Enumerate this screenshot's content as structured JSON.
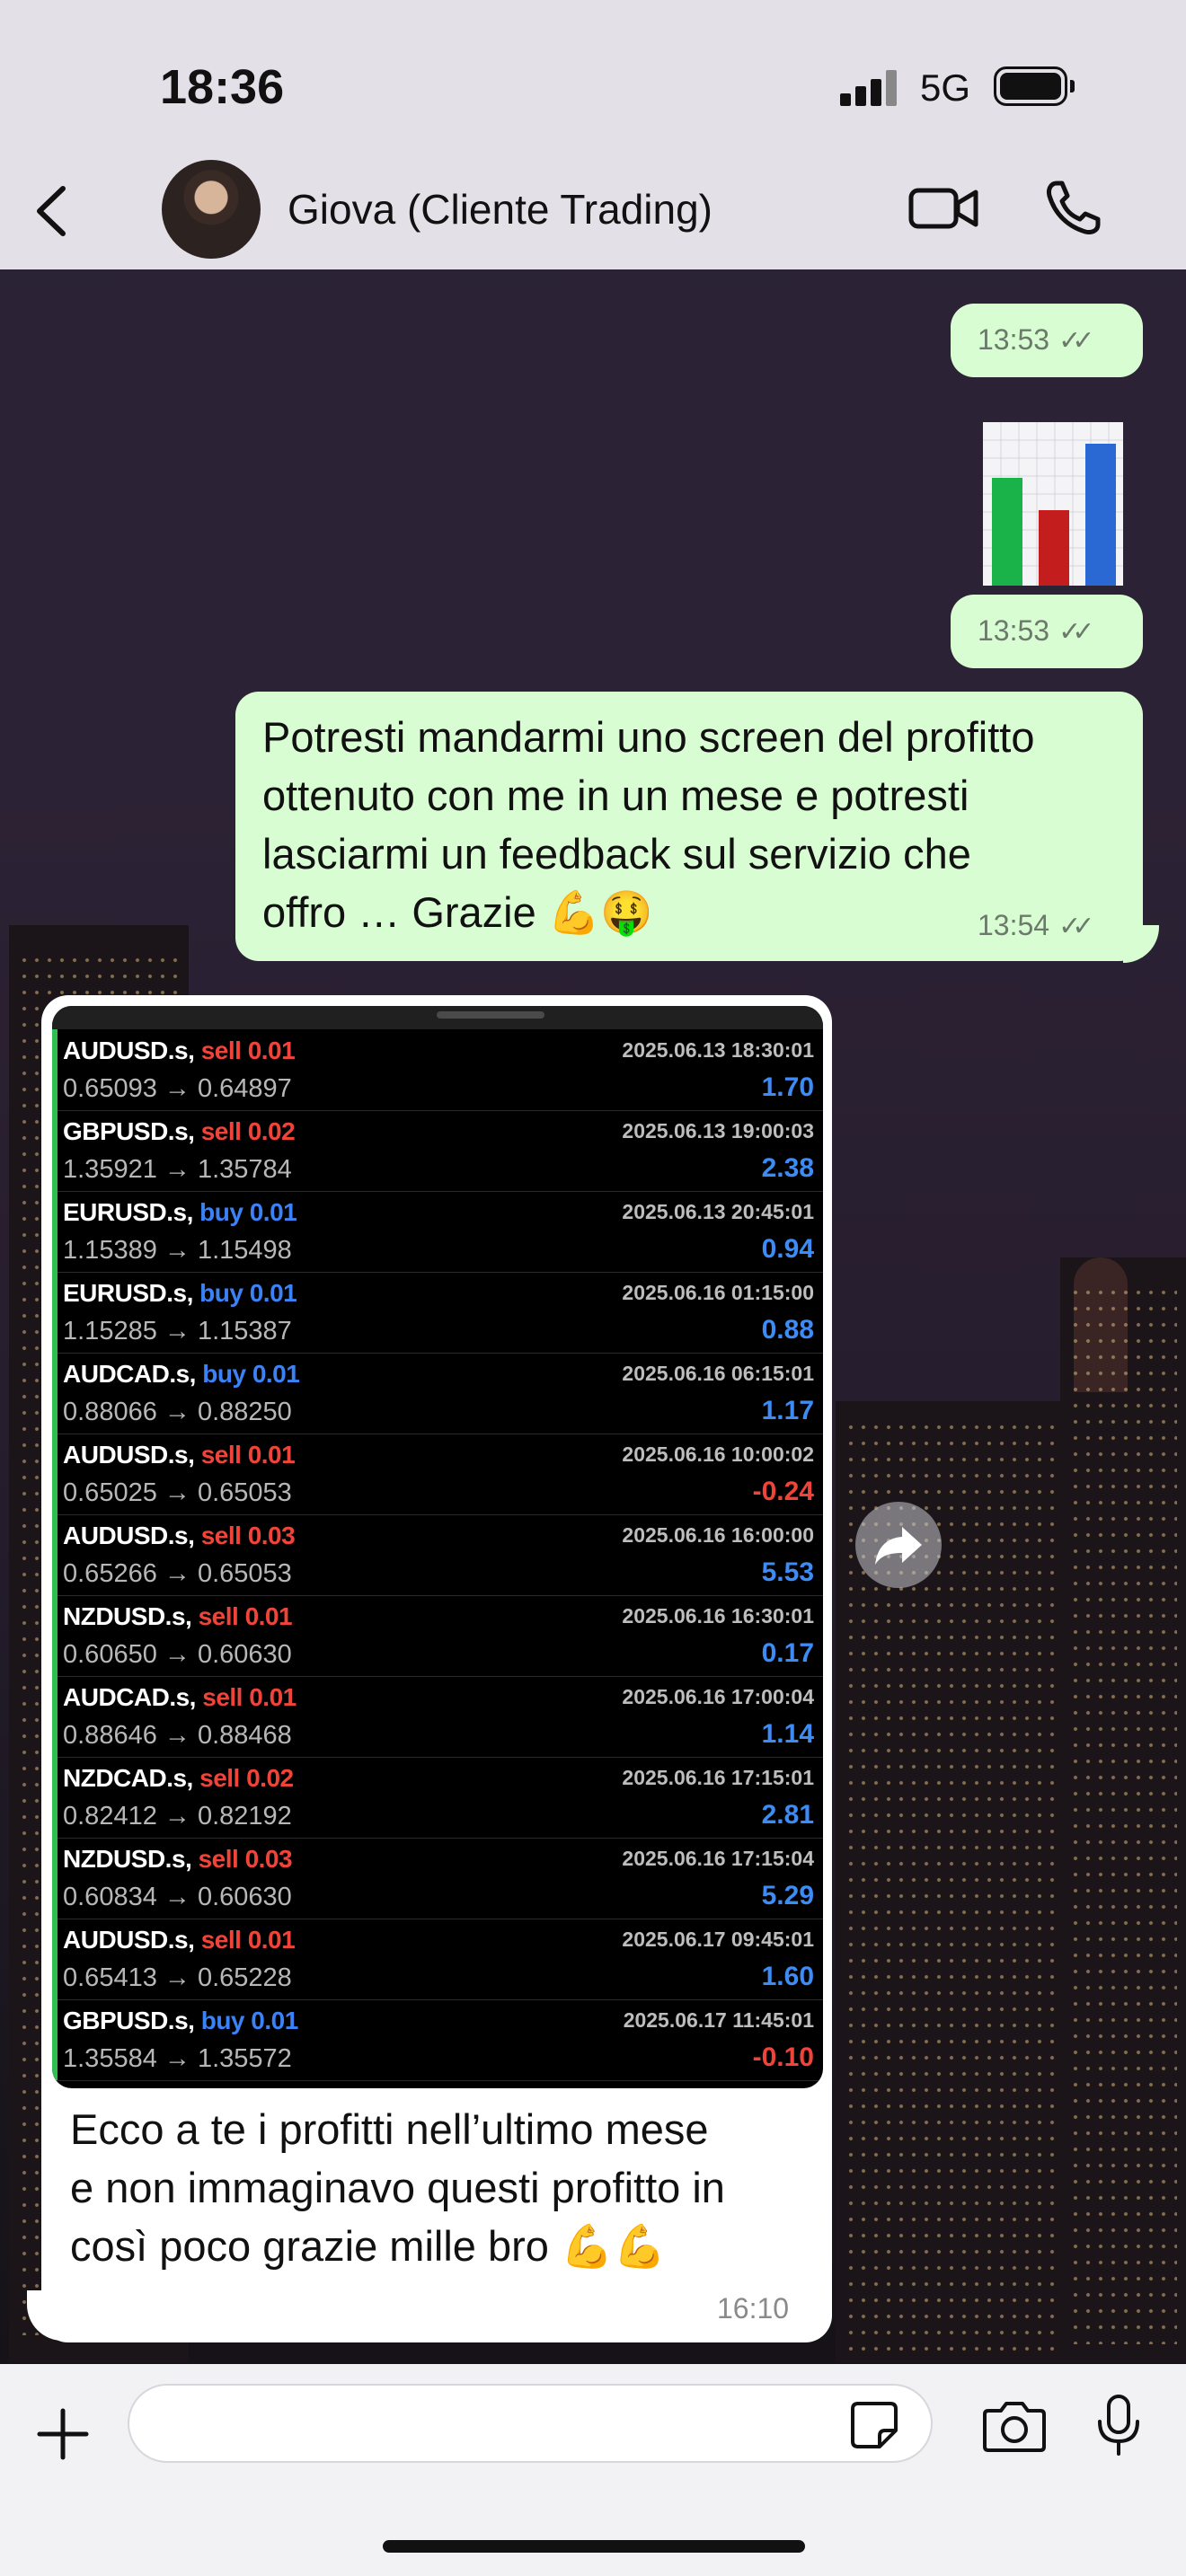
{
  "status": {
    "time": "18:36",
    "network": "5G"
  },
  "header": {
    "contact_name": "Giova (Cliente Trading)"
  },
  "messages": {
    "m1": {
      "time": "13:53"
    },
    "m2": {
      "time": "13:53",
      "emoji": "📊"
    },
    "m3": {
      "lines": [
        "Potresti mandarmi uno screen del profitto",
        "ottenuto con me in un mese e potresti",
        "lasciarmi un feedback sul servizio che",
        "offro … Grazie 💪🤑"
      ],
      "time": "13:54"
    },
    "m4": {
      "lines": [
        "Ecco a te i profitti nell’ultimo mese",
        "e non immaginavo questi profitto in",
        "così poco grazie mille bro 💪💪"
      ],
      "time": "16:10",
      "trades": [
        {
          "symbol": "AUDUSD.s,",
          "side": "sell",
          "lots": "0.01",
          "datetime": "2025.06.13 18:30:01",
          "open": "0.65093",
          "close": "0.64897",
          "profit": "1.70"
        },
        {
          "symbol": "GBPUSD.s,",
          "side": "sell",
          "lots": "0.02",
          "datetime": "2025.06.13 19:00:03",
          "open": "1.35921",
          "close": "1.35784",
          "profit": "2.38"
        },
        {
          "symbol": "EURUSD.s,",
          "side": "buy",
          "lots": "0.01",
          "datetime": "2025.06.13 20:45:01",
          "open": "1.15389",
          "close": "1.15498",
          "profit": "0.94"
        },
        {
          "symbol": "EURUSD.s,",
          "side": "buy",
          "lots": "0.01",
          "datetime": "2025.06.16 01:15:00",
          "open": "1.15285",
          "close": "1.15387",
          "profit": "0.88"
        },
        {
          "symbol": "AUDCAD.s,",
          "side": "buy",
          "lots": "0.01",
          "datetime": "2025.06.16 06:15:01",
          "open": "0.88066",
          "close": "0.88250",
          "profit": "1.17"
        },
        {
          "symbol": "AUDUSD.s,",
          "side": "sell",
          "lots": "0.01",
          "datetime": "2025.06.16 10:00:02",
          "open": "0.65025",
          "close": "0.65053",
          "profit": "-0.24"
        },
        {
          "symbol": "AUDUSD.s,",
          "side": "sell",
          "lots": "0.03",
          "datetime": "2025.06.16 16:00:00",
          "open": "0.65266",
          "close": "0.65053",
          "profit": "5.53"
        },
        {
          "symbol": "NZDUSD.s,",
          "side": "sell",
          "lots": "0.01",
          "datetime": "2025.06.16 16:30:01",
          "open": "0.60650",
          "close": "0.60630",
          "profit": "0.17"
        },
        {
          "symbol": "AUDCAD.s,",
          "side": "sell",
          "lots": "0.01",
          "datetime": "2025.06.16 17:00:04",
          "open": "0.88646",
          "close": "0.88468",
          "profit": "1.14"
        },
        {
          "symbol": "NZDCAD.s,",
          "side": "sell",
          "lots": "0.02",
          "datetime": "2025.06.16 17:15:01",
          "open": "0.82412",
          "close": "0.82192",
          "profit": "2.81"
        },
        {
          "symbol": "NZDUSD.s,",
          "side": "sell",
          "lots": "0.03",
          "datetime": "2025.06.16 17:15:04",
          "open": "0.60834",
          "close": "0.60630",
          "profit": "5.29"
        },
        {
          "symbol": "AUDUSD.s,",
          "side": "sell",
          "lots": "0.01",
          "datetime": "2025.06.17 09:45:01",
          "open": "0.65413",
          "close": "0.65228",
          "profit": "1.60"
        },
        {
          "symbol": "GBPUSD.s,",
          "side": "buy",
          "lots": "0.01",
          "datetime": "2025.06.17 11:45:01",
          "open": "1.35584",
          "close": "1.35572",
          "profit": "-0.10"
        }
      ]
    }
  },
  "icons": {
    "back": "chevron-left-icon",
    "video": "video-camera-icon",
    "call": "phone-icon",
    "forward": "forward-icon",
    "attach": "plus-icon",
    "sticker": "sticker-icon",
    "camera": "camera-icon",
    "mic": "microphone-icon"
  },
  "colors": {
    "outgoing_bubble": "#d9fdd3",
    "sell": "#f0443a",
    "buy": "#3b82f6",
    "profit": "#3d8bf5",
    "loss": "#f0443a",
    "trade_bar": "#2fbe4f"
  }
}
